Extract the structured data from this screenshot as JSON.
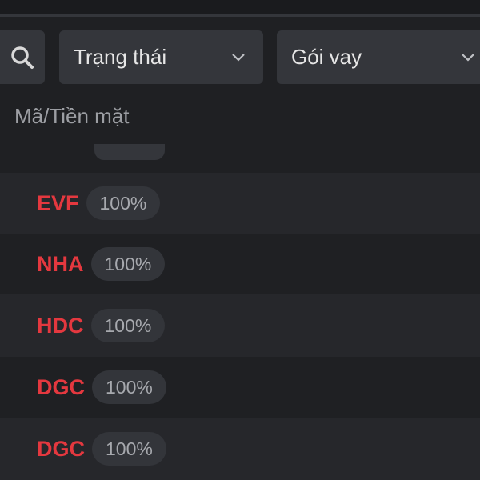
{
  "filters": {
    "search_icon": "search-icon",
    "status_label": "Trạng thái",
    "package_label": "Gói vay",
    "chevron_icon": "chevron-down-icon"
  },
  "table": {
    "column_header": "Mã/Tiền mặt",
    "rows": [
      {
        "code": "EVF",
        "cash_ratio": "100%"
      },
      {
        "code": "NHA",
        "cash_ratio": "100%"
      },
      {
        "code": "HDC",
        "cash_ratio": "100%"
      },
      {
        "code": "DGC",
        "cash_ratio": "100%"
      },
      {
        "code": "DGC",
        "cash_ratio": "100%"
      }
    ]
  },
  "colors": {
    "background": "#1f2023",
    "alt_row": "#26272b",
    "control": "#34363b",
    "code_text": "#e4383f",
    "muted_text": "#9c9ea3"
  }
}
